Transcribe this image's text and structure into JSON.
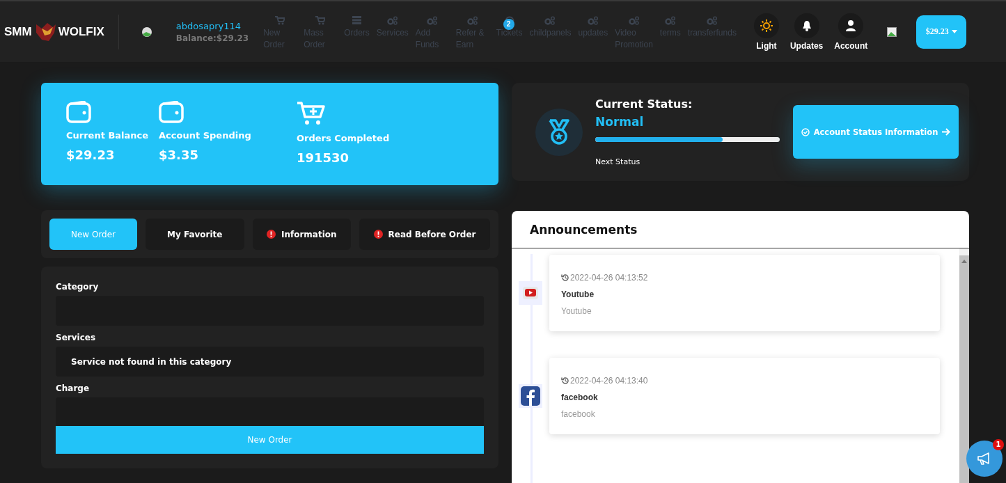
{
  "header": {
    "logo_left": "SMM",
    "logo_right": "WOLFIX",
    "username": "abdosapry114",
    "balance": "Balance:$29.23",
    "nav": [
      {
        "kind": "cart",
        "label": "New Order"
      },
      {
        "kind": "cart",
        "label": "Mass Order"
      },
      {
        "kind": "list",
        "label": "Orders"
      },
      {
        "kind": "gears",
        "label": "Services"
      },
      {
        "kind": "gears",
        "label": "Add Funds"
      },
      {
        "kind": "gears",
        "label": "Refer & Earn"
      },
      {
        "kind": "ticket",
        "label": "Tickets",
        "badge": "2"
      },
      {
        "kind": "gears",
        "label": "childpanels"
      },
      {
        "kind": "gears",
        "label": "updates"
      },
      {
        "kind": "gears",
        "label": "Video Promotion"
      },
      {
        "kind": "gears",
        "label": "terms"
      },
      {
        "kind": "gears",
        "label": "transferfunds"
      }
    ],
    "actions": [
      {
        "kind": "sun",
        "label": "Light"
      },
      {
        "kind": "bell",
        "label": "Updates"
      },
      {
        "kind": "user",
        "label": "Account"
      }
    ],
    "currency_button": "$29.23"
  },
  "stats": [
    {
      "kind": "wallet",
      "label": "Current Balance",
      "value": "$29.23"
    },
    {
      "kind": "wallet",
      "label": "Account Spending",
      "value": "$3.35"
    },
    {
      "kind": "cart",
      "label": "Orders Completed",
      "value": "191530"
    }
  ],
  "status": {
    "title": "Current Status:",
    "value": "Normal",
    "level": 0.69,
    "next": "Next Status",
    "button": "Account Status Information"
  },
  "tabs": [
    {
      "label": "New Order",
      "selected": true,
      "alert": false
    },
    {
      "label": "My Favorite",
      "selected": false,
      "alert": false
    },
    {
      "label": "Information",
      "selected": false,
      "alert": true
    },
    {
      "label": "Read Before Order",
      "selected": false,
      "alert": true
    }
  ],
  "form": {
    "fields": [
      {
        "label": "Category"
      },
      {
        "label": "Services",
        "value": "Service not found in this category"
      },
      {
        "label": "Charge"
      }
    ],
    "submit": "New Order"
  },
  "announcements": {
    "title": "Announcements",
    "items": [
      {
        "kind": "youtube",
        "time": "2022-04-26 04:13:52",
        "title": "Youtube",
        "body": "Youtube"
      },
      {
        "kind": "facebook",
        "time": "2022-04-26 04:13:40",
        "title": "facebook",
        "body": "facebook"
      }
    ]
  },
  "fab": {
    "badge": "1"
  }
}
